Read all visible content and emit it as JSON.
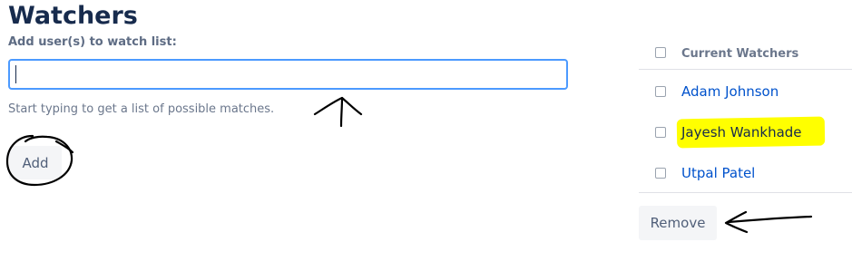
{
  "page": {
    "title": "Watchers"
  },
  "add_form": {
    "label": "Add user(s) to watch list:",
    "input_value": "",
    "help_text": "Start typing to get a list of possible matches.",
    "add_label": "Add"
  },
  "watchers": {
    "header": "Current Watchers",
    "items": [
      {
        "name": "Adam Johnson",
        "highlighted": false
      },
      {
        "name": "Jayesh Wankhade",
        "highlighted": true
      },
      {
        "name": "Utpal Patel",
        "highlighted": false
      }
    ],
    "remove_label": "Remove"
  },
  "colors": {
    "title": "#172b4d",
    "link": "#0052cc",
    "input_border_focus": "#4c9aff",
    "button_bg": "#f4f5f7",
    "highlight": "#ffff00",
    "annotation_ink": "#000000"
  },
  "annotations": {
    "icons": [
      "arrow-up-mark",
      "circle-mark",
      "arrow-left-mark"
    ]
  }
}
